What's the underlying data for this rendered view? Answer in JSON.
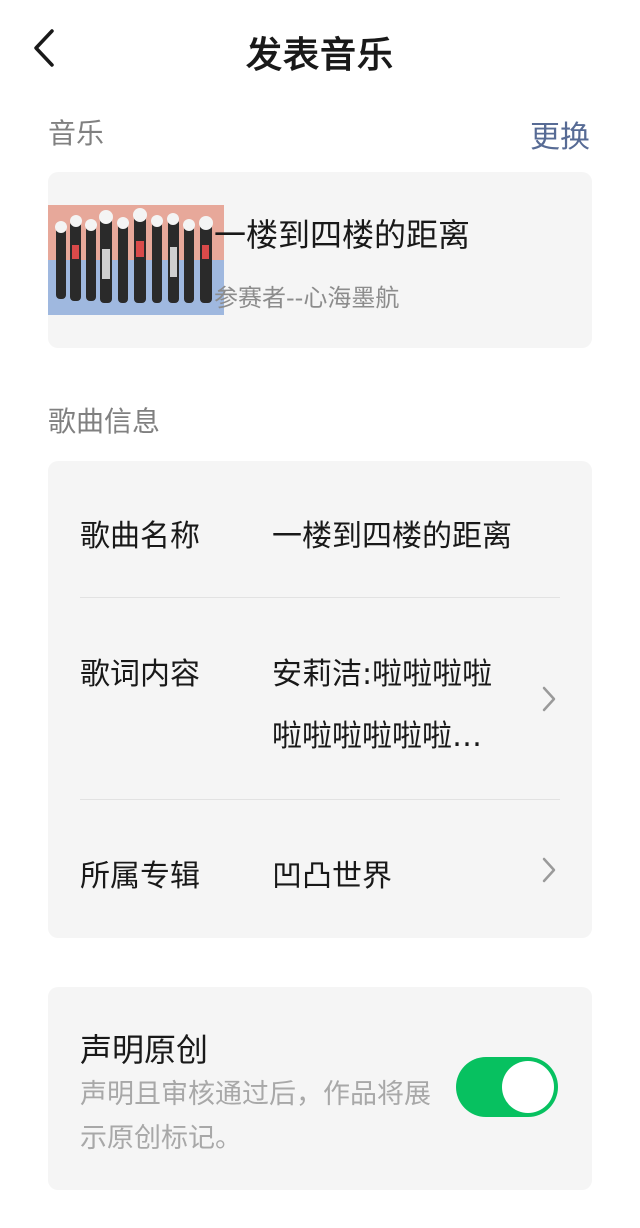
{
  "header": {
    "title": "发表音乐"
  },
  "music_section": {
    "label": "音乐",
    "change_label": "更换",
    "track": {
      "title": "一楼到四楼的距离",
      "artist": "参赛者--心海墨航"
    }
  },
  "info_section": {
    "label": "歌曲信息",
    "rows": [
      {
        "label": "歌曲名称",
        "value": "一楼到四楼的距离"
      },
      {
        "label": "歌词内容",
        "value_line1": "安莉洁:啦啦啦啦",
        "value_line2": "啦啦啦啦啦啦…"
      },
      {
        "label": "所属专辑",
        "value": "凹凸世界"
      }
    ]
  },
  "originality": {
    "title": "声明原创",
    "description": "声明且审核通过后，作品将展示原创标记。",
    "enabled": true
  },
  "icons": {
    "back": "chevron-left-icon",
    "row_arrow": "chevron-right-icon"
  },
  "colors": {
    "accent_link": "#576B95",
    "toggle_on": "#07C160",
    "card_bg": "#F5F5F5"
  }
}
